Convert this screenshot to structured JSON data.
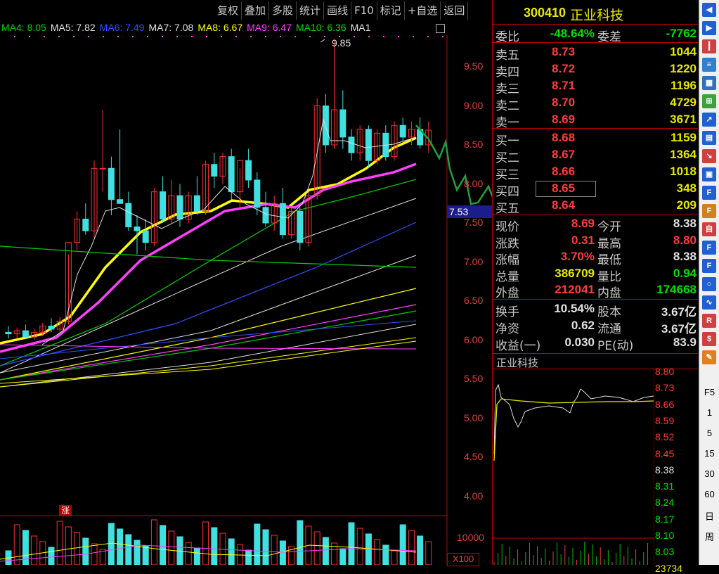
{
  "toolbar": {
    "items": [
      "复权",
      "叠加",
      "多股",
      "统计",
      "画线",
      "F10",
      "标记",
      "+自选",
      "返回"
    ]
  },
  "ma_legend": [
    {
      "label": "MA4: 8.05",
      "color": "#00cc00"
    },
    {
      "label": "MA5: 7.82",
      "color": "#e0e0e0"
    },
    {
      "label": "MA6: 7.49",
      "color": "#3050ff"
    },
    {
      "label": "MA7: 7.08",
      "color": "#e0e0e0"
    },
    {
      "label": "MA8: 6.67",
      "color": "#ffff00"
    },
    {
      "label": "MA9: 6.47",
      "color": "#ff40ff"
    },
    {
      "label": "MA10: 6.36",
      "color": "#00dd00"
    },
    {
      "label": "MA1",
      "color": "#e0e0e0"
    }
  ],
  "chart_data": {
    "type": "candlestick",
    "y_ticks": [
      "9.50",
      "9.00",
      "8.50",
      "8.00",
      "7.50",
      "7.00",
      "6.50",
      "6.00",
      "5.50",
      "5.00",
      "4.50",
      "4.00"
    ],
    "y_values": [
      9.5,
      9.0,
      8.5,
      8.0,
      7.5,
      7.0,
      6.5,
      6.0,
      5.5,
      5.0,
      4.5,
      4.0
    ],
    "peak_label": "9.85",
    "cursor_price": "7.53",
    "limit_up_tag": "涨",
    "volume_ticks": [
      "10000",
      "X100"
    ],
    "ohlc": [
      [
        6.1,
        6.18,
        6.02,
        6.08
      ],
      [
        6.08,
        6.16,
        6.02,
        6.12
      ],
      [
        6.12,
        6.2,
        6.06,
        6.04
      ],
      [
        6.04,
        6.15,
        6.0,
        6.1
      ],
      [
        6.1,
        6.22,
        6.05,
        6.18
      ],
      [
        6.18,
        6.28,
        6.1,
        6.14
      ],
      [
        6.14,
        6.3,
        6.1,
        6.24
      ],
      [
        6.24,
        7.1,
        6.2,
        7.25
      ],
      [
        7.25,
        7.65,
        7.15,
        7.55
      ],
      [
        7.55,
        7.75,
        7.35,
        7.4
      ],
      [
        7.4,
        8.3,
        7.3,
        8.2
      ],
      [
        8.2,
        8.95,
        7.9,
        8.2
      ],
      [
        8.2,
        8.35,
        7.6,
        7.8
      ],
      [
        7.8,
        8.7,
        7.75,
        7.75
      ],
      [
        7.75,
        7.9,
        7.4,
        7.45
      ],
      [
        7.45,
        7.6,
        7.1,
        7.4
      ],
      [
        7.4,
        7.55,
        7.15,
        7.25
      ],
      [
        7.25,
        7.95,
        7.2,
        7.9
      ],
      [
        7.9,
        8.1,
        7.5,
        7.55
      ],
      [
        7.55,
        8.05,
        7.5,
        7.85
      ],
      [
        7.85,
        8.0,
        7.45,
        7.55
      ],
      [
        7.55,
        7.9,
        7.5,
        7.85
      ],
      [
        7.85,
        8.1,
        7.6,
        7.65
      ],
      [
        7.65,
        8.3,
        7.6,
        8.25
      ],
      [
        8.25,
        8.4,
        7.95,
        8.1
      ],
      [
        8.1,
        8.4,
        8.0,
        8.35
      ],
      [
        8.35,
        8.45,
        7.8,
        7.9
      ],
      [
        7.9,
        8.2,
        7.7,
        8.3
      ],
      [
        8.3,
        8.45,
        7.95,
        8.05
      ],
      [
        8.05,
        8.15,
        7.6,
        7.7
      ],
      [
        7.7,
        7.9,
        7.45,
        7.5
      ],
      [
        7.5,
        7.85,
        7.4,
        7.75
      ],
      [
        7.75,
        7.95,
        7.3,
        7.35
      ],
      [
        7.35,
        7.7,
        7.3,
        7.65
      ],
      [
        7.65,
        7.7,
        7.15,
        7.25
      ],
      [
        7.25,
        7.9,
        7.2,
        7.85
      ],
      [
        7.85,
        9.1,
        7.8,
        9.0
      ],
      [
        9.0,
        9.15,
        8.4,
        8.5
      ],
      [
        8.5,
        9.85,
        8.45,
        8.95
      ],
      [
        8.95,
        9.2,
        8.45,
        8.6
      ],
      [
        8.6,
        8.7,
        8.3,
        8.4
      ],
      [
        8.4,
        8.75,
        8.3,
        8.7
      ],
      [
        8.7,
        8.75,
        8.2,
        8.3
      ],
      [
        8.3,
        8.7,
        8.25,
        8.65
      ],
      [
        8.65,
        8.75,
        8.3,
        8.35
      ],
      [
        8.35,
        8.8,
        8.3,
        8.75
      ],
      [
        8.75,
        8.85,
        8.55,
        8.6
      ],
      [
        8.6,
        8.8,
        8.5,
        8.7
      ],
      [
        8.7,
        8.85,
        8.45,
        8.5
      ],
      [
        8.5,
        8.8,
        8.4,
        8.69
      ]
    ]
  },
  "stock": {
    "code": "300410",
    "name": "正业科技"
  },
  "quote": {
    "weibi_label": "委比",
    "weibi": "-48.64%",
    "weicha_label": "委差",
    "weicha": "-7762",
    "sell": [
      {
        "label": "卖五",
        "price": "8.73",
        "qty": "1044"
      },
      {
        "label": "卖四",
        "price": "8.72",
        "qty": "1220"
      },
      {
        "label": "卖三",
        "price": "8.71",
        "qty": "1196"
      },
      {
        "label": "卖二",
        "price": "8.70",
        "qty": "4729"
      },
      {
        "label": "卖一",
        "price": "8.69",
        "qty": "3671"
      }
    ],
    "buy": [
      {
        "label": "买一",
        "price": "8.68",
        "qty": "1159"
      },
      {
        "label": "买二",
        "price": "8.67",
        "qty": "1364"
      },
      {
        "label": "买三",
        "price": "8.66",
        "qty": "1018"
      },
      {
        "label": "买四",
        "price": "8.65",
        "qty": "348"
      },
      {
        "label": "买五",
        "price": "8.64",
        "qty": "209"
      }
    ],
    "stats": [
      {
        "l": "现价",
        "v": "8.69",
        "vc": "#ff3c3c",
        "l2": "今开",
        "v2": "8.38",
        "v2c": "#e0e0e0"
      },
      {
        "l": "涨跌",
        "v": "0.31",
        "vc": "#ff3c3c",
        "l2": "最高",
        "v2": "8.80",
        "v2c": "#ff3c3c"
      },
      {
        "l": "涨幅",
        "v": "3.70%",
        "vc": "#ff3c3c",
        "l2": "最低",
        "v2": "8.38",
        "v2c": "#e0e0e0"
      },
      {
        "l": "总量",
        "v": "386709",
        "vc": "#e8e800",
        "l2": "量比",
        "v2": "0.94",
        "v2c": "#00e000"
      },
      {
        "l": "外盘",
        "v": "212041",
        "vc": "#ff3c3c",
        "l2": "内盘",
        "v2": "174668",
        "v2c": "#00e000"
      }
    ],
    "fin": [
      {
        "l": "换手",
        "v": "10.54%",
        "l2": "股本",
        "v2": "3.67亿"
      },
      {
        "l": "净资",
        "v": "0.62",
        "l2": "流通",
        "v2": "3.67亿"
      },
      {
        "l": "收益(一)",
        "v": "0.030",
        "l2": "PE(动)",
        "v2": "83.9"
      }
    ]
  },
  "mini": {
    "title": "正业科技",
    "labels": [
      "8.80",
      "8.73",
      "8.66",
      "8.59",
      "8.52",
      "8.45",
      "8.38",
      "8.31",
      "8.24",
      "8.17",
      "8.10",
      "8.03",
      "23734"
    ],
    "colors": [
      "#ff3c3c",
      "#ff3c3c",
      "#ff3c3c",
      "#ff3c3c",
      "#ff3c3c",
      "#ff3c3c",
      "#e0e0e0",
      "#00e000",
      "#00e000",
      "#00e000",
      "#00e000",
      "#00e000",
      "#e8e800"
    ]
  },
  "sidebar": {
    "icons": [
      "arrow-left-icon",
      "arrow-right-icon",
      "candle-icon",
      "list-icon",
      "table-icon",
      "grid-icon",
      "line-chart-icon",
      "bar-chart-icon",
      "trend-icon",
      "doc-icon",
      "f10-icon",
      "f-icon",
      "zi-icon",
      "f12-icon",
      "f5-icon",
      "circle-icon",
      "wave-icon",
      "rsi-icon",
      "dollar-icon",
      "pencil-icon"
    ],
    "periods": [
      "F5",
      "1",
      "5",
      "15",
      "30",
      "60",
      "日",
      "周"
    ]
  }
}
